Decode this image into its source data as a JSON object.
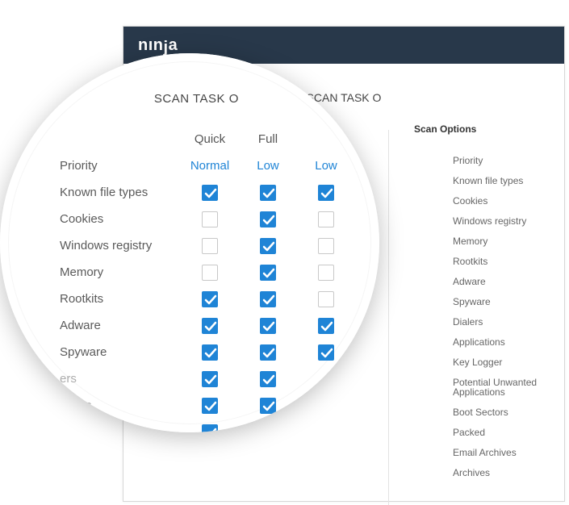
{
  "app": {
    "logo_pre": "nın",
    "logo_j": "j",
    "logo_post": "a"
  },
  "bg": {
    "scan_task_title": "SCAN TASK O",
    "scan_options_heading": "Scan Options",
    "options": [
      "Priority",
      "Known file types",
      "Cookies",
      "Windows registry",
      "Memory",
      "Rootkits",
      "Adware",
      "Spyware",
      "Dialers",
      "Applications",
      "Key Logger",
      "Potential Unwanted Applications",
      "Boot Sectors",
      "Packed",
      "Email Archives",
      "Archives"
    ]
  },
  "lens": {
    "title": "SCAN TASK O",
    "columns": [
      "Quick",
      "Full",
      ""
    ],
    "rows": [
      {
        "label": "Priority",
        "quick": "Normal",
        "full": "Low",
        "third": "Low"
      },
      {
        "label": "Known file types",
        "quick": true,
        "full": true,
        "third": true
      },
      {
        "label": "Cookies",
        "quick": false,
        "full": true,
        "third": false
      },
      {
        "label": "Windows registry",
        "quick": false,
        "full": true,
        "third": false
      },
      {
        "label": "Memory",
        "quick": false,
        "full": true,
        "third": false
      },
      {
        "label": "Rootkits",
        "quick": true,
        "full": true,
        "third": false
      },
      {
        "label": "Adware",
        "quick": true,
        "full": true,
        "third": true
      },
      {
        "label": "Spyware",
        "quick": true,
        "full": true,
        "third": true
      },
      {
        "label": "ers",
        "quick": true,
        "full": true
      },
      {
        "label": "s",
        "quick": true,
        "full": true
      }
    ]
  },
  "colors": {
    "accent": "#1f84d6",
    "header": "#28384a"
  }
}
